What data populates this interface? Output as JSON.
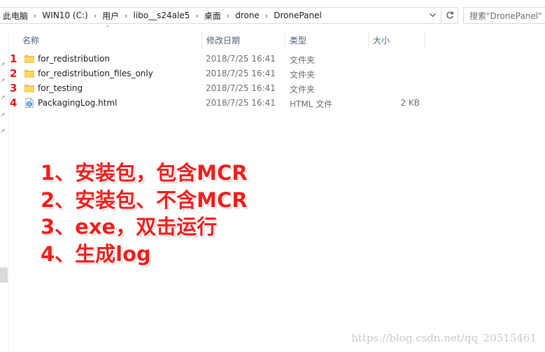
{
  "address_bar": {
    "crumbs": [
      "此电脑",
      "WIN10 (C:)",
      "用户",
      "libo__s24ale5",
      "桌面",
      "drone",
      "DronePanel"
    ],
    "separator": "›"
  },
  "search": {
    "placeholder": "搜索\"DronePanel\""
  },
  "columns": {
    "name": "名称",
    "modified": "修改日期",
    "type": "类型",
    "size": "大小"
  },
  "files": [
    {
      "num": "1",
      "name": "for_redistribution",
      "date": "2018/7/25 16:41",
      "type": "文件夹",
      "size": "",
      "icon": "folder-icon"
    },
    {
      "num": "2",
      "name": "for_redistribution_files_only",
      "date": "2018/7/25 16:41",
      "type": "文件夹",
      "size": "",
      "icon": "folder-icon"
    },
    {
      "num": "3",
      "name": "for_testing",
      "date": "2018/7/25 16:41",
      "type": "文件夹",
      "size": "",
      "icon": "folder-icon"
    },
    {
      "num": "4",
      "name": "PackagingLog.html",
      "date": "2018/7/25 16:41",
      "type": "HTML 文件",
      "size": "2 KB",
      "icon": "html-file-icon"
    }
  ],
  "annotations": [
    "1、安装包，包含MCR",
    "2、安装包、不含MCR",
    "3、exe，双击运行",
    "4、生成log"
  ],
  "watermark": "https://blog.csdn.net/qq_20515461",
  "colors": {
    "annotation": "#e8211f",
    "folder": "#f5c94d",
    "header_text": "#4c607a"
  }
}
